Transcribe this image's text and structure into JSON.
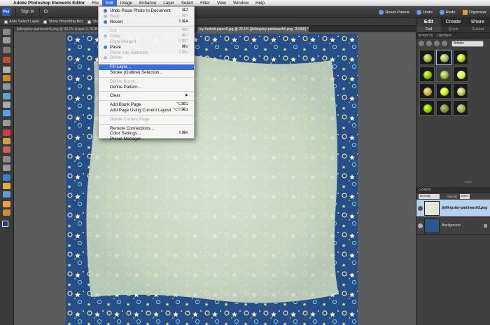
{
  "menubar": {
    "app_name": "Adobe Photoshop Elements Editor",
    "items": [
      "File",
      "Edit",
      "Image",
      "Enhance",
      "Layer",
      "Select",
      "Filter",
      "View",
      "Window",
      "Help"
    ]
  },
  "appbar": {
    "sign_in": "Sign In",
    "create_partial": "Cr",
    "reset_panels": "Reset Panels",
    "undo": "Undo",
    "redo": "Redo",
    "organizer": "Organizer"
  },
  "options_bar": {
    "auto_select_layer": "Auto Select Layer",
    "show_bounding_box": "Show Bounding Box",
    "show_highlight_partial": "Show Hig"
  },
  "doc_tabs": [
    {
      "label": "jbillingsley-paintwash5.png @ 30.2% (Layer 0, RGB/8) *"
    },
    {
      "label": "ley-funfetti-paper8.jpg @ 29.1% (jbillingsley-paintwash5.png, RGB/8) *"
    }
  ],
  "edit_menu": {
    "items": [
      {
        "label": "Undo Place Photo In Document",
        "shortcut": "⌘Z",
        "disabled": false,
        "icon": true
      },
      {
        "label": "Redo",
        "shortcut": "⌘Y",
        "disabled": true,
        "icon": true
      },
      {
        "label": "Revert",
        "shortcut": "⇧⌘A",
        "disabled": false,
        "icon": true
      },
      {
        "sep": true
      },
      {
        "label": "Cut",
        "shortcut": "⌘X",
        "disabled": true,
        "icon": false
      },
      {
        "label": "Copy",
        "shortcut": "⌘C",
        "disabled": true,
        "icon": true
      },
      {
        "label": "Copy Merged",
        "shortcut": "⇧⌘C",
        "disabled": true,
        "icon": false
      },
      {
        "label": "Paste",
        "shortcut": "⌘V",
        "disabled": false,
        "icon": true
      },
      {
        "label": "Paste Into Selection",
        "shortcut": "⇧⌘V",
        "disabled": true,
        "icon": false
      },
      {
        "label": "Delete",
        "shortcut": "",
        "disabled": true,
        "icon": true
      },
      {
        "sep": true
      },
      {
        "label": "Fill Layer...",
        "shortcut": "",
        "disabled": false,
        "icon": false,
        "highlight": true
      },
      {
        "label": "Stroke (Outline) Selection...",
        "shortcut": "",
        "disabled": false,
        "icon": false
      },
      {
        "sep": true
      },
      {
        "label": "Define Brush...",
        "shortcut": "",
        "disabled": true,
        "icon": false
      },
      {
        "label": "Define Pattern...",
        "shortcut": "",
        "disabled": false,
        "icon": false
      },
      {
        "sep": true
      },
      {
        "label": "Clear",
        "shortcut": "",
        "disabled": false,
        "icon": false,
        "submenu": true
      },
      {
        "sep": true
      },
      {
        "label": "Add Blank Page",
        "shortcut": "⌥⌘G",
        "disabled": false,
        "icon": false
      },
      {
        "label": "Add Page Using Current Layout",
        "shortcut": "⌥⇧⌘G",
        "disabled": false,
        "icon": false
      },
      {
        "sep": true
      },
      {
        "label": "Delete Current Page",
        "shortcut": "",
        "disabled": true,
        "icon": false
      },
      {
        "sep": true
      },
      {
        "label": "Remote Connections...",
        "shortcut": "",
        "disabled": false,
        "icon": false
      },
      {
        "label": "Color Settings...",
        "shortcut": "⇧⌘K",
        "disabled": false,
        "icon": false
      },
      {
        "label": "Preset Manager...",
        "shortcut": "",
        "disabled": false,
        "icon": false
      }
    ]
  },
  "right_panel": {
    "mode_tabs": [
      "Edit",
      "Create",
      "Share"
    ],
    "sub_tabs": [
      "Full",
      "Quick",
      "Guided"
    ],
    "effects_header": [
      "EFFECTS",
      "CONTENT"
    ],
    "effects_category": "Artistic",
    "apply_label": "Apply",
    "layers_header": "LAYERS",
    "blend_mode": "Normal",
    "opacity_label": "Opacity:",
    "opacity_value": "100%",
    "layers": [
      {
        "name": "jbillingsley-paintwash5.png",
        "selected": true,
        "locked": false
      },
      {
        "name": "Background",
        "selected": false,
        "locked": true
      }
    ]
  },
  "colors": {
    "menu_highlight": "#3b6ed6",
    "paper_blue": "#264e87",
    "wash_cream": "#dfe6cf"
  }
}
